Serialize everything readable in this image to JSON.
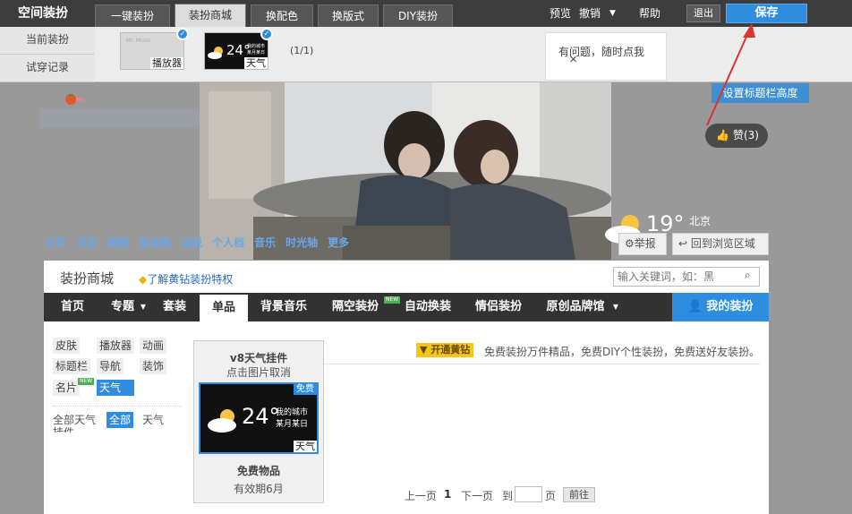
{
  "topbar": {
    "logo": "空间装扮",
    "tabs": [
      {
        "label": "一键装扮",
        "active": false
      },
      {
        "label": "装扮商城",
        "active": true
      },
      {
        "label": "换配色",
        "active": false
      },
      {
        "label": "换版式",
        "active": false
      },
      {
        "label": "DIY装扮",
        "active": false
      }
    ],
    "preview": "预览",
    "undo": "撤销",
    "help": "帮助",
    "exit": "退出",
    "save": "保存"
  },
  "subbar": {
    "items": [
      "当前装扮",
      "试穿记录"
    ],
    "thumbs": [
      {
        "label": "播放器",
        "text": "Mr. Music"
      },
      {
        "label": "天气",
        "temp": "24°",
        "city": "我的城市",
        "date": "某月某日"
      }
    ],
    "page": "(1/1)",
    "tooltip": "有问题，随时点我",
    "tooltip_close": "✕"
  },
  "canvas": {
    "set_height_button": "设置标题栏高度",
    "like_button": "赞(3)",
    "weather_temp": "19°",
    "weather_city": "北京",
    "report_button": "举报",
    "back_button": "回到浏览区域",
    "nav": [
      "主页",
      "日志",
      "相册",
      "留言板",
      "说说",
      "个人档",
      "音乐",
      "时光轴",
      "更多"
    ]
  },
  "mall": {
    "title": "装扮商城",
    "vip_link": "了解黄钻装扮特权",
    "search_placeholder": "输入关键词，如：黑",
    "nav": [
      "首页",
      "专题",
      "套装",
      "单品",
      "背景音乐",
      "隔空装扮",
      "自动换装",
      "情侣装扮",
      "原创品牌馆"
    ],
    "nav_active": "单品",
    "new_badge": "NEW",
    "my_button": "我的装扮",
    "categories": [
      "皮肤",
      "播放器",
      "动画",
      "标题栏",
      "导航",
      "装饰",
      "名片",
      "天气"
    ],
    "category_selected": "天气",
    "filters": [
      "全部天气",
      "全部",
      "天气",
      "挂件"
    ],
    "filter_selected": "全部",
    "promo_button": "开通黄钻",
    "promo_text": "免费装扮万件精品，免费DIY个性装扮，免费送好友装扮。",
    "product": {
      "name": "v8天气挂件",
      "hint": "点击图片取消",
      "badge": "免费",
      "temp": "24°",
      "city": "我的城市",
      "date": "某月某日",
      "tag": "天气",
      "price": "免费物品",
      "validity": "有效期6月"
    },
    "pagination": {
      "prev": "上一页",
      "current": "1",
      "next": "下一页",
      "goto": "到",
      "unit": "页",
      "go": "前往"
    }
  }
}
